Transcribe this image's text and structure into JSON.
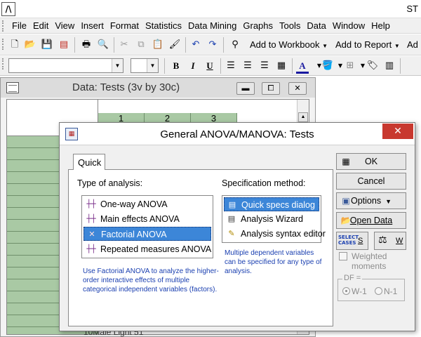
{
  "app": {
    "icon_text": "/\\",
    "title_fragment": "ST"
  },
  "menu": {
    "items": [
      "File",
      "Edit",
      "View",
      "Insert",
      "Format",
      "Statistics",
      "Data Mining",
      "Graphs",
      "Tools",
      "Data",
      "Window",
      "Help"
    ]
  },
  "toolbar1": {
    "add_to_workbook": "Add to Workbook",
    "add_to_report": "Add to Report",
    "truncated": "Ad"
  },
  "toolbar2": {
    "bold": "B",
    "italic": "I",
    "underline": "U",
    "font_color_letter": "A"
  },
  "datawindow": {
    "title": "Data: Tests (3v by 30c)",
    "column_numbers": [
      "1",
      "2",
      "3"
    ],
    "visible_row_fragment": "10Male     Light     51"
  },
  "dialog": {
    "title": "General ANOVA/MANOVA: Tests",
    "close_glyph": "✕",
    "tab_quick": "Quick",
    "type_of_analysis_label": "Type of analysis:",
    "analysis_types": [
      "One-way ANOVA",
      "Main effects ANOVA",
      "Factorial ANOVA",
      "Repeated measures ANOVA"
    ],
    "selected_analysis": "Factorial ANOVA",
    "spec_method_label": "Specification method:",
    "spec_methods": [
      "Quick specs dialog",
      "Analysis Wizard",
      "Analysis syntax editor"
    ],
    "selected_spec": "Quick specs dialog",
    "spec_hint": "Multiple dependent variables can be specified for any type of analysis.",
    "analysis_hint": "Use Factorial ANOVA to analyze the higher-order interactive effects of multiple categorical independent variables (factors).",
    "buttons": {
      "ok": "OK",
      "cancel": "Cancel",
      "options": "Options",
      "open_data": "Open Data",
      "select_cases_line1": "SELECT",
      "select_cases_line2": "CASES",
      "select_s": "S",
      "weight_w": "W"
    },
    "weighted_moments": "Weighted moments",
    "df_label": "DF =",
    "df_options": [
      "W-1",
      "N-1"
    ],
    "df_selected": "W-1"
  },
  "colors": {
    "selection": "#3c86d8",
    "grid_header": "#a9c9a4",
    "close": "#c8382f",
    "hint_text": "#1a3fb0"
  }
}
